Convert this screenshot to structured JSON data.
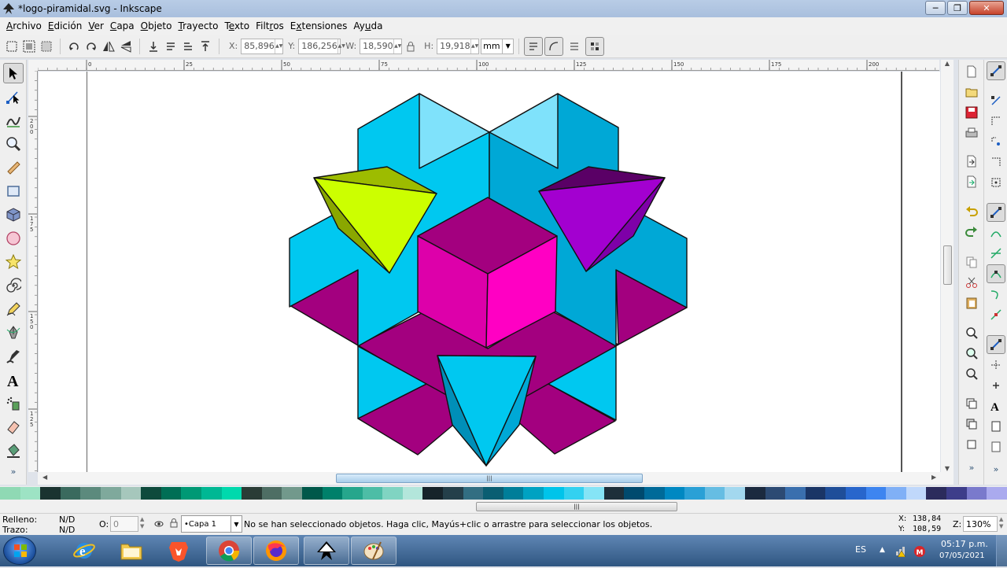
{
  "window": {
    "title": "*logo-piramidal.svg - Inkscape"
  },
  "menu": [
    {
      "pre": "",
      "u": "A",
      "post": "rchivo"
    },
    {
      "pre": "",
      "u": "E",
      "post": "dición"
    },
    {
      "pre": "",
      "u": "V",
      "post": "er"
    },
    {
      "pre": "",
      "u": "C",
      "post": "apa"
    },
    {
      "pre": "",
      "u": "O",
      "post": "bjeto"
    },
    {
      "pre": "",
      "u": "T",
      "post": "rayecto"
    },
    {
      "pre": "T",
      "u": "e",
      "post": "xto"
    },
    {
      "pre": "Filt",
      "u": "r",
      "post": "os"
    },
    {
      "pre": "E",
      "u": "x",
      "post": "tensiones"
    },
    {
      "pre": "Ay",
      "u": "u",
      "post": "da"
    }
  ],
  "coords": {
    "x_label": "X:",
    "x_value": "85,896",
    "y_label": "Y:",
    "y_value": "186,256",
    "w_label": "W:",
    "w_value": "18,590",
    "h_label": "H:",
    "h_value": "19,918",
    "unit": "mm"
  },
  "ruler": {
    "top_ticks": [
      "0",
      "25",
      "50",
      "75",
      "100",
      "125",
      "150",
      "175",
      "200"
    ],
    "left_ticks": [
      "200",
      "175",
      "150",
      "125"
    ]
  },
  "palette": [
    "#8fd9b4",
    "#9de3c4",
    "#1a3330",
    "#3a6a5e",
    "#5c8a7d",
    "#7fa99c",
    "#a6c7bc",
    "#0e4a3c",
    "#006e55",
    "#009975",
    "#00b894",
    "#00d9ad",
    "#2a3c36",
    "#4e6e64",
    "#72998c",
    "#00584a",
    "#00806a",
    "#26a68c",
    "#4dbda6",
    "#80d4c2",
    "#b3e6db",
    "#16232a",
    "#243f4a",
    "#326e82",
    "#0a5e72",
    "#007e99",
    "#00a2c2",
    "#00c4ea",
    "#33d1f0",
    "#85e4f6",
    "#1d2f3a",
    "#004a6e",
    "#006a99",
    "#0088c2",
    "#2aa0d6",
    "#66bde3",
    "#a3d8ef",
    "#1b2a3f",
    "#2c4a73",
    "#3a6fae",
    "#1a3566",
    "#1f4e99",
    "#2866cc",
    "#3d85f0",
    "#80b0f6",
    "#c0d8fb",
    "#2b2b5c",
    "#3d3d8a",
    "#7a7acc",
    "#aaaaee"
  ],
  "status": {
    "fill_label": "Relleno:",
    "fill_value": "N/D",
    "stroke_label": "Trazo:",
    "stroke_value": "N/D",
    "opacity_label": "O:",
    "opacity_value": "0",
    "layer": "•Capa 1",
    "message": "No se han seleccionado objetos. Haga clic, Mayús+clic o arrastre para seleccionar los objetos.",
    "cursor_x_label": "X:",
    "cursor_x": "138,84",
    "cursor_y_label": "Y:",
    "cursor_y": "108,59",
    "zoom_label": "Z:",
    "zoom": "130%"
  },
  "taskbar": {
    "lang": "ES",
    "time": "05:17 p.m.",
    "date": "07/05/2021"
  }
}
